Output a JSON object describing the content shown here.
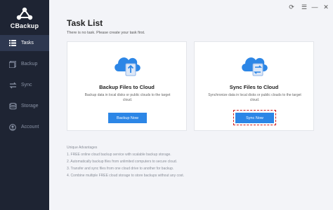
{
  "app": {
    "name": "CBackup"
  },
  "sidebar": {
    "items": [
      {
        "label": "Tasks",
        "icon": "list-icon",
        "active": true
      },
      {
        "label": "Backup",
        "icon": "backup-icon",
        "active": false
      },
      {
        "label": "Sync",
        "icon": "sync-icon",
        "active": false
      },
      {
        "label": "Storage",
        "icon": "storage-icon",
        "active": false
      },
      {
        "label": "Account",
        "icon": "account-icon",
        "active": false
      }
    ]
  },
  "window_controls": {
    "refresh": "⟳",
    "menu": "☰",
    "minimize": "—",
    "close": "✕"
  },
  "main": {
    "title": "Task List",
    "subtitle": "There is no task. Please create your task first."
  },
  "cards": {
    "backup": {
      "title": "Backup Files to Cloud",
      "description": "Backup data in local disks or public clouds to the target cloud.",
      "button": "Backup Now"
    },
    "sync": {
      "title": "Sync Files to Cloud",
      "description": "Synchronize data in local disks or public clouds to the target cloud.",
      "button": "Sync Now"
    }
  },
  "advantages": {
    "heading": "Unique Advantages",
    "items": [
      "1. FREE online cloud backup service with scalable backup storage.",
      "2. Automatically backup files from unlimited computers to secure cloud.",
      "3. Transfer and sync files from one cloud drive to another for backup.",
      "4. Combine multiple FREE cloud storage to store backups without any cost."
    ]
  },
  "colors": {
    "sidebar_bg": "#1e2433",
    "sidebar_active": "#2e3850",
    "accent": "#2c86e6",
    "highlight": "#d01919"
  }
}
